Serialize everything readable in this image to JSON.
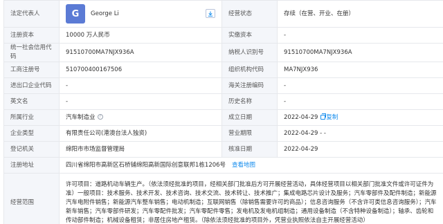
{
  "rows": {
    "legal_rep": {
      "label": "法定代表人",
      "avatar_letter": "G",
      "name": "George Li",
      "download_icon": "download-icon"
    },
    "status": {
      "label": "经营状态",
      "value": "存续（在营、开业、在册）"
    },
    "reg_capital": {
      "label": "注册资本",
      "value": "10000 万人民币"
    },
    "paid_capital": {
      "label": "实缴资本",
      "value": "-"
    },
    "credit_code": {
      "label": "统一社会信用代码",
      "value": "91510700MA7NJX936A"
    },
    "taxpayer_id": {
      "label": "纳税人识别号",
      "value": "91510700MA7NJX936A"
    },
    "reg_number": {
      "label": "工商注册号",
      "value": "510700400167506"
    },
    "org_code": {
      "label": "组织机构代码",
      "value": "MA7NJX936"
    },
    "import_export": {
      "label": "进出口企业代码",
      "value": "-"
    },
    "customs": {
      "label": "海关注册编码",
      "value": "-"
    },
    "english_name": {
      "label": "英文名",
      "value": "-"
    },
    "former_name": {
      "label": "历史名称",
      "value": "-"
    },
    "industry": {
      "label": "所属行业",
      "value": "汽车制造业",
      "help_icon": "question-circle-icon"
    },
    "founded": {
      "label": "成立日期",
      "value": "2022-04-29",
      "copy_label": "复制",
      "copy_icon": "copy-icon"
    },
    "company_type": {
      "label": "企业类型",
      "value": "有限责任公司(港澳台法人独资)"
    },
    "business_term": {
      "label": "营业期限",
      "value": "2022-04-29 - -"
    },
    "authority": {
      "label": "登记机关",
      "value": "绵阳市市场监督管理局"
    },
    "approval_date": {
      "label": "核准日期",
      "value": "2022-04-29"
    },
    "address": {
      "label": "注册地址",
      "value": "四川省绵阳市高新区石桥铺绵阳高新国际创意联邦1栋1206号",
      "map_link": "查看地图"
    },
    "scope": {
      "label": "经营范围",
      "value": "许可项目：道路机动车辆生产。（依法须经批准的项目，经相关部门批准后方可开展经营活动，具体经营项目以相关部门批准文件或许可证件为准）一般项目：技术服务、技术开发、技术咨询、技术交流、技术转让、技术推广；集成电路芯片设计及服务；汽车零部件及配件制造；新能源汽车电附件销售；新能源汽车整车销售；电动机制造；互联网销售（除销售需要许可的商品）；信息咨询服务（不含许可类信息咨询服务）；汽车新车销售；汽车零部件研发；汽车零配件批发；汽车零配件零售；发电机及发电机组制造；通用设备制造（不含特种设备制造）；轴承、齿轮和传动部件制造；机械设备租赁；非居住房地产租赁。（除依法须经批准的项目外，凭营业执照依法自主开展经营活动）"
    }
  },
  "colors": {
    "label_bg": "#f4f6fa",
    "border": "#e6e8ec",
    "link": "#128bed",
    "avatar_bg": "#5b7bd5"
  }
}
